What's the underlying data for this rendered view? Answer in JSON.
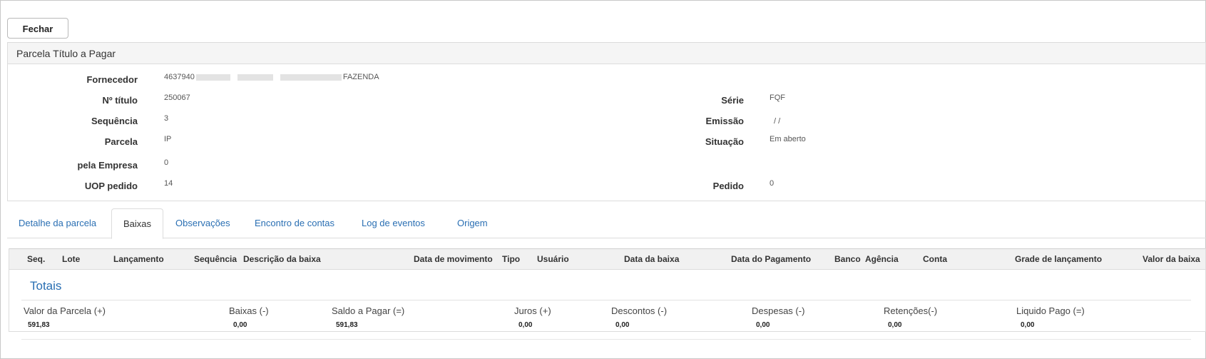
{
  "toolbar": {
    "close_label": "Fechar"
  },
  "panel": {
    "title": "Parcela Título a Pagar",
    "fields": {
      "fornecedor": {
        "label": "Fornecedor",
        "value_prefix": "4637940",
        "value_suffix": "FAZENDA"
      },
      "numero_titulo": {
        "label": "Nº título",
        "value": "250067"
      },
      "serie": {
        "label": "Série",
        "value": "FQF"
      },
      "sequencia": {
        "label": "Sequência",
        "value": "3"
      },
      "emissao": {
        "label": "Emissão",
        "value": "/ /"
      },
      "parcela": {
        "label": "Parcela",
        "value": "IP"
      },
      "situacao": {
        "label": "Situação",
        "value": "Em aberto"
      },
      "pela_empresa": {
        "label": "pela Empresa",
        "value": "0"
      },
      "uop_pedido": {
        "label": "UOP pedido",
        "value": "14"
      },
      "pedido": {
        "label": "Pedido",
        "value": "0"
      }
    }
  },
  "tabs": [
    {
      "label": "Detalhe da parcela",
      "active": false
    },
    {
      "label": "Baixas",
      "active": true
    },
    {
      "label": "Observações",
      "active": false
    },
    {
      "label": "Encontro de contas",
      "active": false
    },
    {
      "label": "Log de eventos",
      "active": false
    },
    {
      "label": "Origem",
      "active": false
    }
  ],
  "grid": {
    "columns": [
      "Seq.",
      "Lote",
      "Lançamento",
      "Sequência",
      "Descrição da baixa",
      "Data de movimento",
      "Tipo",
      "Usuário",
      "Data da baixa",
      "Data do Pagamento",
      "Banco",
      "Agência",
      "Conta",
      "Grade de lançamento",
      "Valor da baixa"
    ]
  },
  "totais": {
    "title": "Totais",
    "items": [
      {
        "label": "Valor da Parcela (+)",
        "value": "591,83"
      },
      {
        "label": "Baixas (-)",
        "value": "0,00"
      },
      {
        "label": "Saldo a Pagar (=)",
        "value": "591,83"
      },
      {
        "label": "Juros (+)",
        "value": "0,00"
      },
      {
        "label": "Descontos (-)",
        "value": "0,00"
      },
      {
        "label": "Despesas (-)",
        "value": "0,00"
      },
      {
        "label": "Retenções(-)",
        "value": "0,00"
      },
      {
        "label": "Liquido Pago (=)",
        "value": "0,00"
      }
    ]
  }
}
